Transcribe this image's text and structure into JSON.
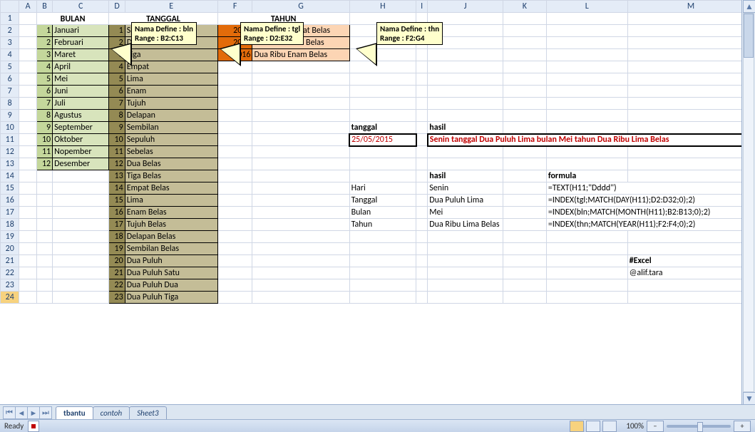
{
  "columns": [
    "A",
    "B",
    "C",
    "D",
    "E",
    "F",
    "G",
    "H",
    "I",
    "J",
    "K",
    "L",
    "M"
  ],
  "headers": {
    "bulan": "BULAN",
    "tanggal": "TANGGAL",
    "tahun": "TAHUN"
  },
  "callouts": {
    "c1a": "Nama Define : bln",
    "c1b": "Range : B2:C13",
    "c2a": "Nama Define : tgl",
    "c2b": "Range : D2:E32",
    "c3a": "Nama Define : thn",
    "c3b": "Range : F2:G4"
  },
  "bulan": [
    {
      "n": "1",
      "t": "Januari"
    },
    {
      "n": "2",
      "t": "Februari"
    },
    {
      "n": "3",
      "t": "Maret"
    },
    {
      "n": "4",
      "t": "April"
    },
    {
      "n": "5",
      "t": "Mei"
    },
    {
      "n": "6",
      "t": "Juni"
    },
    {
      "n": "7",
      "t": "Juli"
    },
    {
      "n": "8",
      "t": "Agustus"
    },
    {
      "n": "9",
      "t": "September"
    },
    {
      "n": "10",
      "t": "Oktober"
    },
    {
      "n": "11",
      "t": "Nopember"
    },
    {
      "n": "12",
      "t": "Desember"
    }
  ],
  "tgl": [
    {
      "n": "1",
      "t": "Satu"
    },
    {
      "n": "2",
      "t": "Dua"
    },
    {
      "n": "3",
      "t": "Tiga"
    },
    {
      "n": "4",
      "t": "Empat"
    },
    {
      "n": "5",
      "t": "Lima"
    },
    {
      "n": "6",
      "t": "Enam"
    },
    {
      "n": "7",
      "t": "Tujuh"
    },
    {
      "n": "8",
      "t": "Delapan"
    },
    {
      "n": "9",
      "t": "Sembilan"
    },
    {
      "n": "10",
      "t": "Sepuluh"
    },
    {
      "n": "11",
      "t": "Sebelas"
    },
    {
      "n": "12",
      "t": "Dua Belas"
    },
    {
      "n": "13",
      "t": "Tiga Belas"
    },
    {
      "n": "14",
      "t": "Empat Belas"
    },
    {
      "n": "15",
      "t": "Lima"
    },
    {
      "n": "16",
      "t": "Enam Belas"
    },
    {
      "n": "17",
      "t": "Tujuh Belas"
    },
    {
      "n": "18",
      "t": "Delapan Belas"
    },
    {
      "n": "19",
      "t": "Sembilan Belas"
    },
    {
      "n": "20",
      "t": "Dua Puluh"
    },
    {
      "n": "21",
      "t": "Dua Puluh Satu"
    },
    {
      "n": "22",
      "t": "Dua Puluh Dua"
    },
    {
      "n": "23",
      "t": "Dua Puluh Tiga"
    }
  ],
  "thn": [
    {
      "n": "2014",
      "t": "Dua Ribu Empat Belas"
    },
    {
      "n": "2015",
      "t": "Dua Ribu Lima Belas"
    },
    {
      "n": "2016",
      "t": "Dua Ribu Enam Belas"
    }
  ],
  "labels": {
    "tanggal_lbl": "tanggal",
    "hasil_lbl": "hasil",
    "hasil_lbl2": "hasil",
    "formula_lbl": "formula",
    "hari": "Hari",
    "l_tanggal": "Tanggal",
    "l_bulan": "Bulan",
    "l_tahun": "Tahun"
  },
  "vals": {
    "date": "25/05/2015",
    "sentence": "Senin tanggal Dua Puluh Lima bulan Mei tahun Dua Ribu Lima Belas",
    "hari": "Senin",
    "tanggal": "Dua Puluh Lima",
    "bulan": "Mei",
    "tahun": "Dua Ribu Lima Belas"
  },
  "formulas": {
    "hari": "=TEXT(H11;\"Dddd\")",
    "tanggal": "=INDEX(tgl;MATCH(DAY(H11);D2:D32;0);2)",
    "bulan": "=INDEX(bln;MATCH(MONTH(H11);B2:B13;0);2)",
    "tahun": "=INDEX(thn;MATCH(YEAR(H11);F2:F4;0);2)"
  },
  "notes": {
    "excel": "#Excel",
    "author": "@alif.tara"
  },
  "tabs": {
    "t1": "tbantu",
    "t2": "contoh",
    "t3": "Sheet3"
  },
  "status": {
    "ready": "Ready",
    "zoom": "100%"
  }
}
